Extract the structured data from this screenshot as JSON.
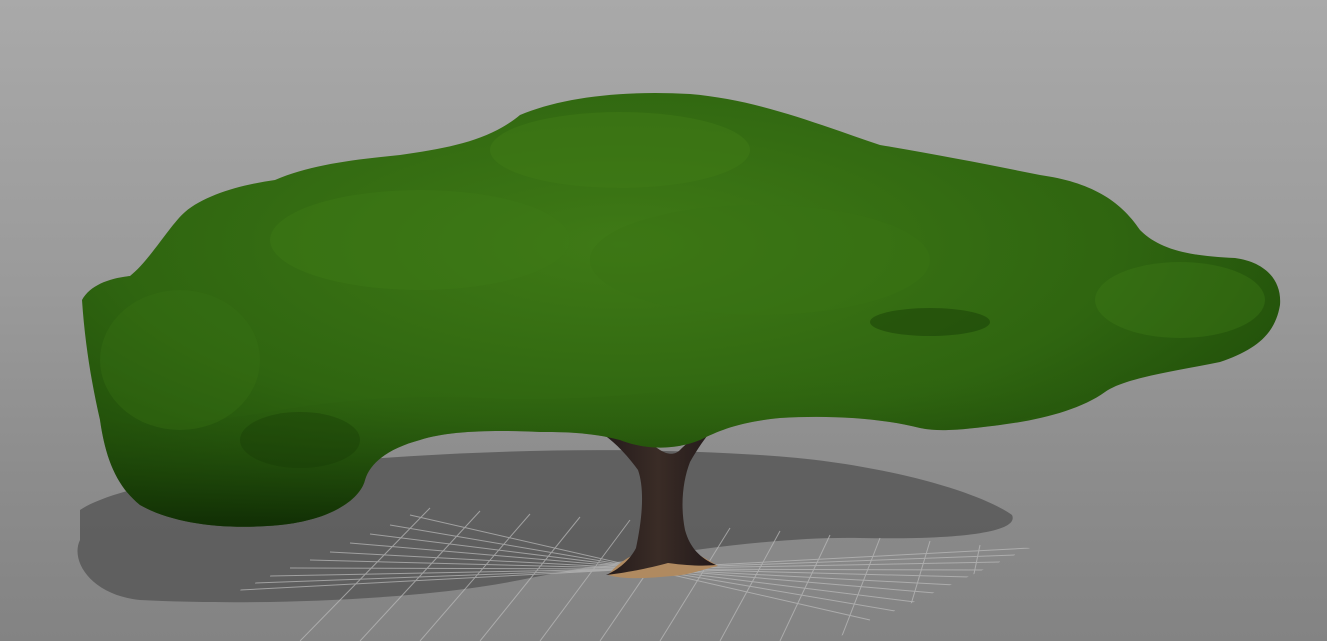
{
  "scene": {
    "subject": "tree-model",
    "colors": {
      "background_top": "#a9a9a9",
      "background_bottom": "#838383",
      "foliage_light": "#3f7a16",
      "foliage_mid": "#2f6510",
      "foliage_dark": "#163a06",
      "trunk": "#3a2c26",
      "trunk_dark": "#22191a",
      "root_base": "#b08a60",
      "shadow": "#555555",
      "grid_line": "#bdbdbd"
    },
    "shows_ground_grid": true,
    "shows_shadow": true
  }
}
